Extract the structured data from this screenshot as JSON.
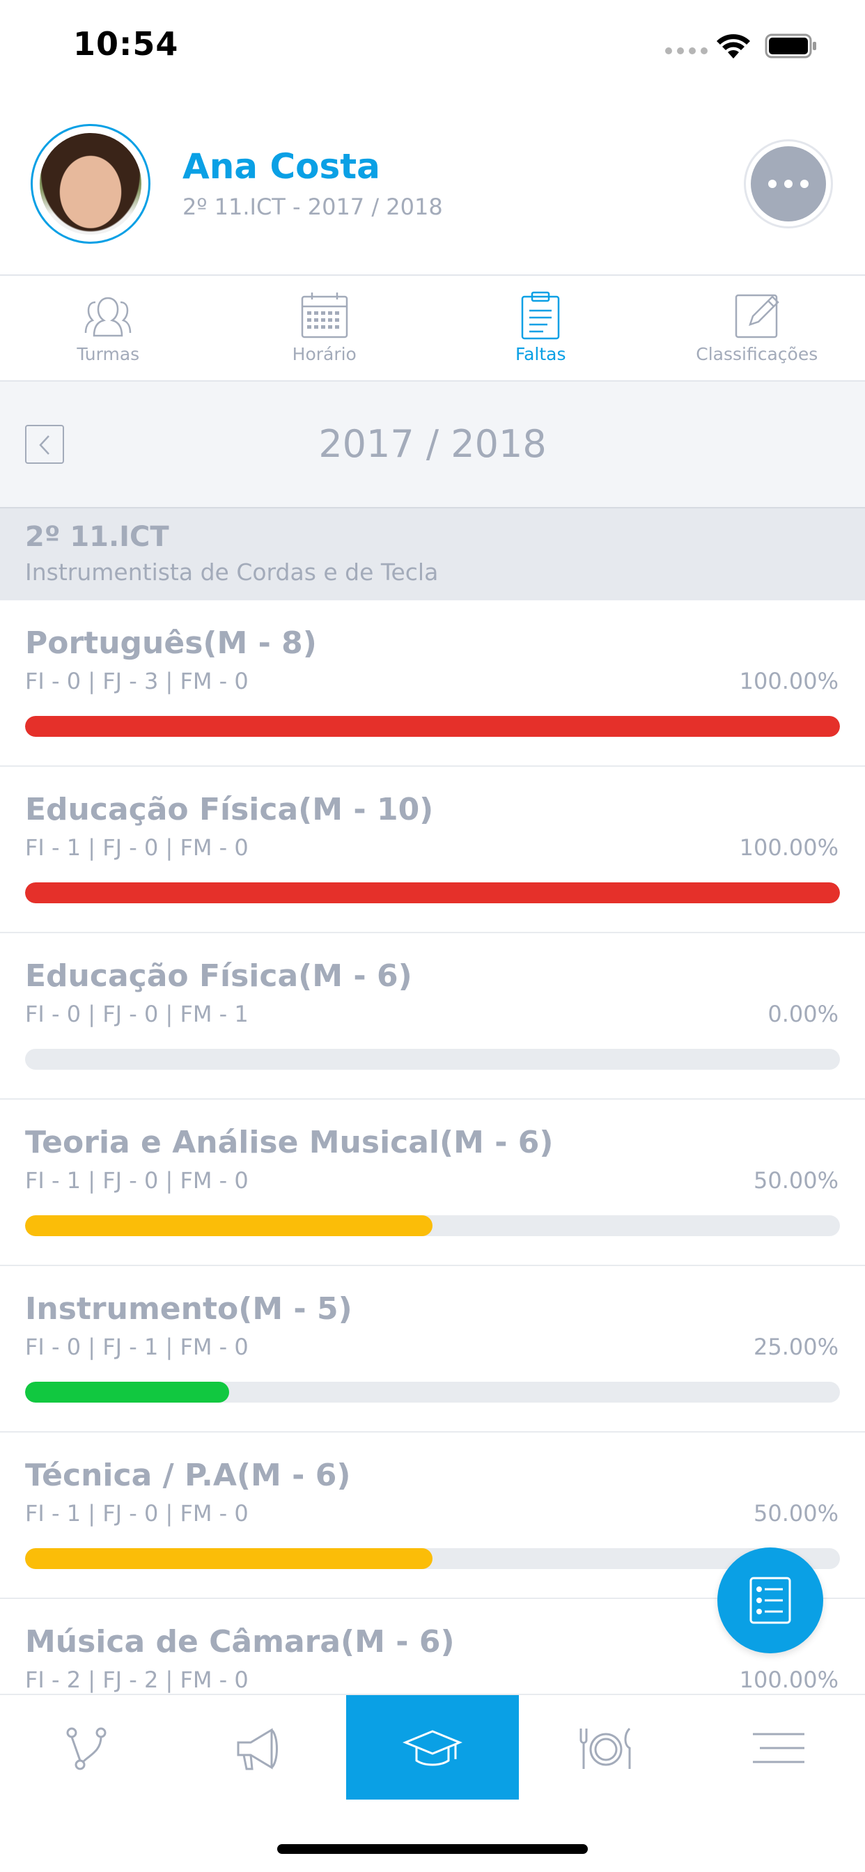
{
  "status_bar": {
    "time": "10:54"
  },
  "profile": {
    "name": "Ana Costa",
    "subtitle": "2º 11.ICT - 2017 / 2018"
  },
  "tabs": [
    {
      "label": "Turmas",
      "icon": "people-icon",
      "active": false
    },
    {
      "label": "Horário",
      "icon": "calendar-icon",
      "active": false
    },
    {
      "label": "Faltas",
      "icon": "clipboard-icon",
      "active": true
    },
    {
      "label": "Classificações",
      "icon": "edit-icon",
      "active": false
    }
  ],
  "year_selector": {
    "year": "2017 / 2018"
  },
  "class_info": {
    "code": "2º 11.ICT",
    "name": "Instrumentista de Cordas e de Tecla"
  },
  "subjects": [
    {
      "title": "Português(M - 8)",
      "counts": "FI - 0  |  FJ - 3  |  FM - 0",
      "percent": "100.00%",
      "fraction": 1.0,
      "color": "#e5302a"
    },
    {
      "title": "Educação Física(M - 10)",
      "counts": "FI - 1  |  FJ - 0  |  FM - 0",
      "percent": "100.00%",
      "fraction": 1.0,
      "color": "#e5302a"
    },
    {
      "title": "Educação Física(M - 6)",
      "counts": "FI - 0  |  FJ - 0  |  FM - 1",
      "percent": "0.00%",
      "fraction": 0.0,
      "color": "#e5302a"
    },
    {
      "title": "Teoria e Análise Musical(M - 6)",
      "counts": "FI - 1  |  FJ - 0  |  FM - 0",
      "percent": "50.00%",
      "fraction": 0.5,
      "color": "#fbbd08"
    },
    {
      "title": "Instrumento(M - 5)",
      "counts": "FI - 0  |  FJ - 1  |  FM - 0",
      "percent": "25.00%",
      "fraction": 0.25,
      "color": "#11c840"
    },
    {
      "title": "Técnica / P.A(M - 6)",
      "counts": "FI - 1  |  FJ - 0  |  FM - 0",
      "percent": "50.00%",
      "fraction": 0.5,
      "color": "#fbbd08"
    },
    {
      "title": "Música de Câmara(M - 6)",
      "counts": "FI - 2  |  FJ - 2  |  FM - 0",
      "percent": "100.00%",
      "fraction": 1.0,
      "color": "#e5302a"
    }
  ],
  "fab": {
    "icon": "list-icon"
  },
  "bottom_nav": [
    {
      "icon": "branch-icon",
      "active": false
    },
    {
      "icon": "megaphone-icon",
      "active": false
    },
    {
      "icon": "graduation-cap-icon",
      "active": true
    },
    {
      "icon": "dining-icon",
      "active": false
    },
    {
      "icon": "menu-icon",
      "active": false
    }
  ],
  "colors": {
    "accent": "#0aa0e5",
    "text_muted": "#a3abba",
    "danger": "#e5302a",
    "warning": "#fbbd08",
    "success": "#11c840"
  }
}
